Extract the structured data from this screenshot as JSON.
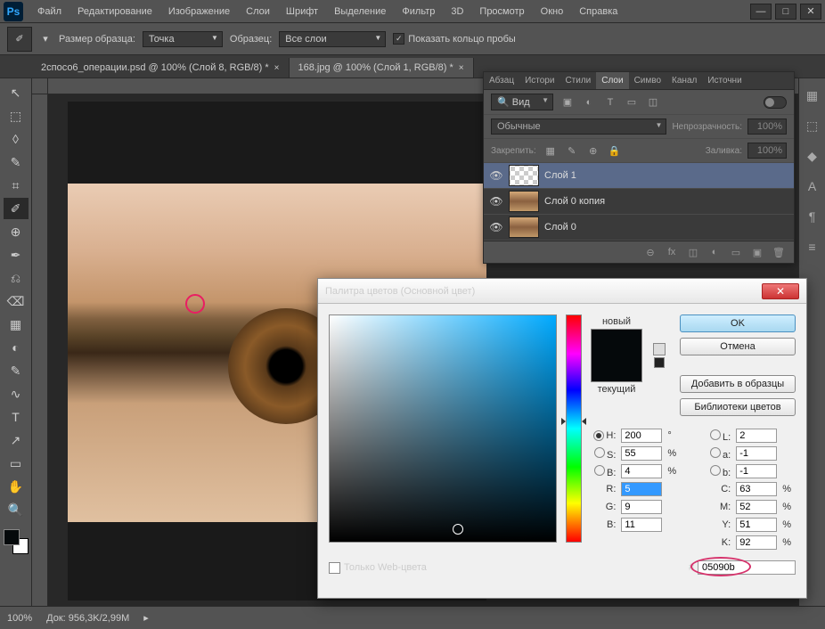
{
  "app": {
    "logo": "Ps"
  },
  "menu": [
    "Файл",
    "Редактирование",
    "Изображение",
    "Слои",
    "Шрифт",
    "Выделение",
    "Фильтр",
    "3D",
    "Просмотр",
    "Окно",
    "Справка"
  ],
  "window_controls": [
    "—",
    "□",
    "✕"
  ],
  "options": {
    "sample_size_label": "Размер образца:",
    "sample_size_value": "Точка",
    "sample_label": "Образец:",
    "sample_value": "Все слои",
    "show_ring": "Показать кольцо пробы"
  },
  "tabs": [
    {
      "title": "2спосо6_операции.psd @ 100% (Слой 8, RGB/8) *",
      "active": false
    },
    {
      "title": "168.jpg @ 100% (Слой 1, RGB/8) *",
      "active": true
    }
  ],
  "tools": [
    "↖",
    "⬚",
    "◊",
    "✎",
    "⌗",
    "✐",
    "⊕",
    "✒",
    "⎌",
    "⌫",
    "▦",
    "◐",
    "✎",
    "∿",
    "T",
    "↗",
    "▭",
    "✋",
    "🔍"
  ],
  "active_tool_index": 5,
  "status": {
    "zoom": "100%",
    "doc": "Док: 956,3K/2,99M"
  },
  "dock_icons": [
    "▦",
    "⬚",
    "◆",
    "A",
    "¶",
    "≡"
  ],
  "layers_panel": {
    "tabs": [
      "Абзац",
      "Истори",
      "Стили",
      "Слои",
      "Симво",
      "Канал",
      "Источни"
    ],
    "active_tab": 3,
    "kind_label": "Вид",
    "filter_icons": [
      "▣",
      "◐",
      "T",
      "▭",
      "◫"
    ],
    "blend": "Обычные",
    "opacity_label": "Непрозрачность:",
    "opacity": "100%",
    "lock_label": "Закрепить:",
    "lock_icons": [
      "▦",
      "✎",
      "⊕",
      "🔒"
    ],
    "fill_label": "Заливка:",
    "fill": "100%",
    "layers": [
      {
        "name": "Слой 1",
        "thumb": "checker",
        "selected": true
      },
      {
        "name": "Слой 0 копия",
        "thumb": "eye",
        "selected": false
      },
      {
        "name": "Слой 0",
        "thumb": "eye",
        "selected": false
      }
    ],
    "footer_icons": [
      "⊖",
      "fx",
      "◫",
      "◐",
      "▭",
      "▣",
      "🗑"
    ]
  },
  "color_picker": {
    "title": "Палитра цветов (Основной цвет)",
    "new_label": "новый",
    "current_label": "текущий",
    "ok": "OK",
    "cancel": "Отмена",
    "add": "Добавить в образцы",
    "libraries": "Библиотеки цветов",
    "H": "200",
    "S": "55",
    "Bv": "4",
    "R": "5",
    "G": "9",
    "Bb": "11",
    "L": "2",
    "a": "-1",
    "b": "-1",
    "C": "63",
    "M": "52",
    "Y": "51",
    "K": "92",
    "hex": "05090b",
    "web_only": "Только Web-цвета",
    "deg": "°",
    "pct": "%",
    "hash": "#"
  }
}
